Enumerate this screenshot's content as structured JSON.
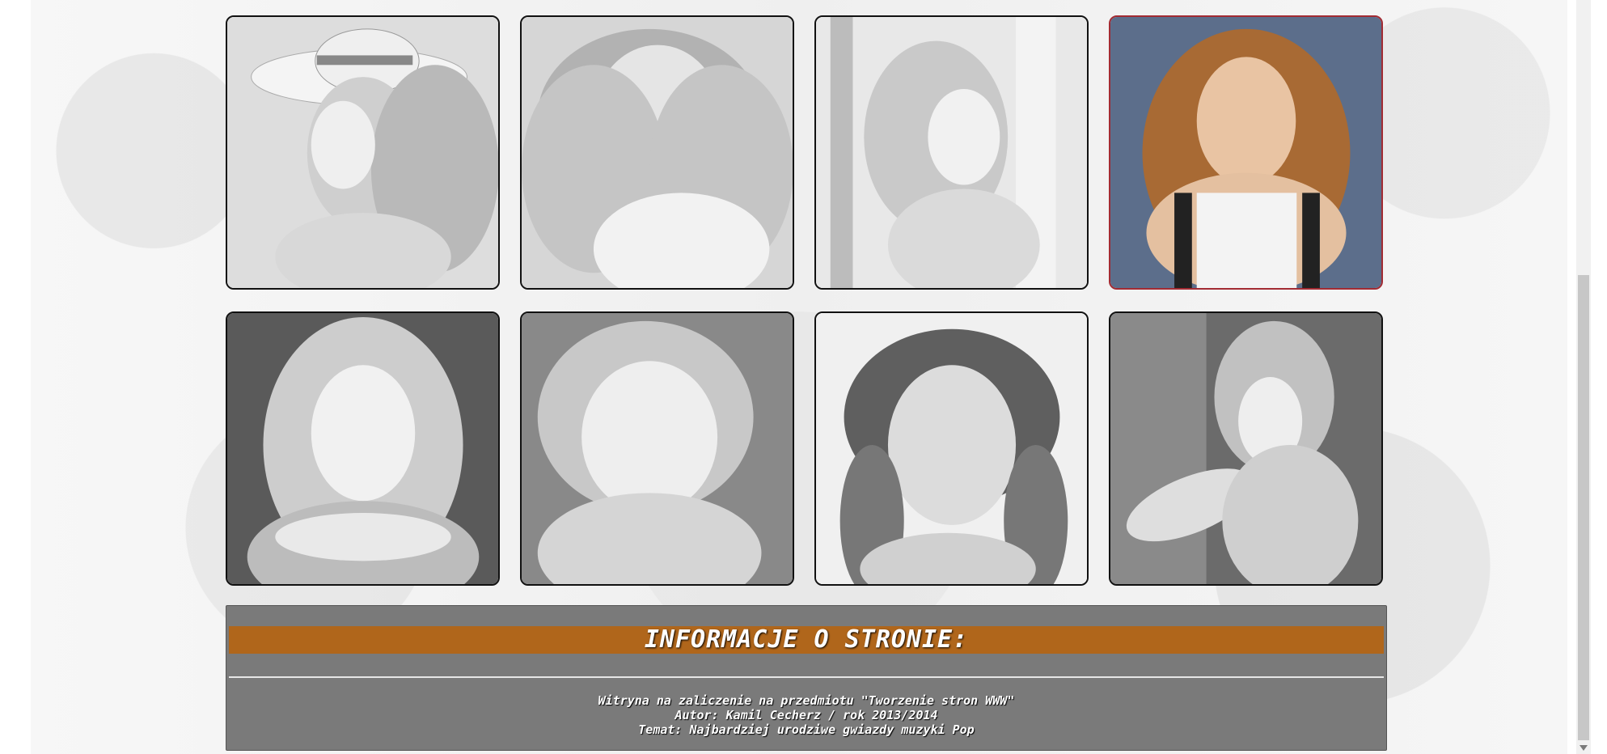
{
  "gallery": {
    "photos": [
      {
        "alt": "photo-1",
        "active": false
      },
      {
        "alt": "photo-2",
        "active": false
      },
      {
        "alt": "photo-3",
        "active": false
      },
      {
        "alt": "photo-4",
        "active": true
      },
      {
        "alt": "photo-5",
        "active": false
      },
      {
        "alt": "photo-6",
        "active": false
      },
      {
        "alt": "photo-7",
        "active": false
      },
      {
        "alt": "photo-8",
        "active": false
      }
    ]
  },
  "footer": {
    "heading": "INFORMACJE O STRONIE:",
    "line1": "Witryna na zaliczenie na przedmiotu \"Tworzenie stron WWW\"",
    "line2": "Autor: Kamil Cecherz / rok 2013/2014",
    "line3": "Temat: Najbardziej urodziwe gwiazdy muzyki Pop"
  },
  "colors": {
    "accent": "#b0661b",
    "footer_bg": "#7a7a7a",
    "active_border": "#a22b33"
  }
}
